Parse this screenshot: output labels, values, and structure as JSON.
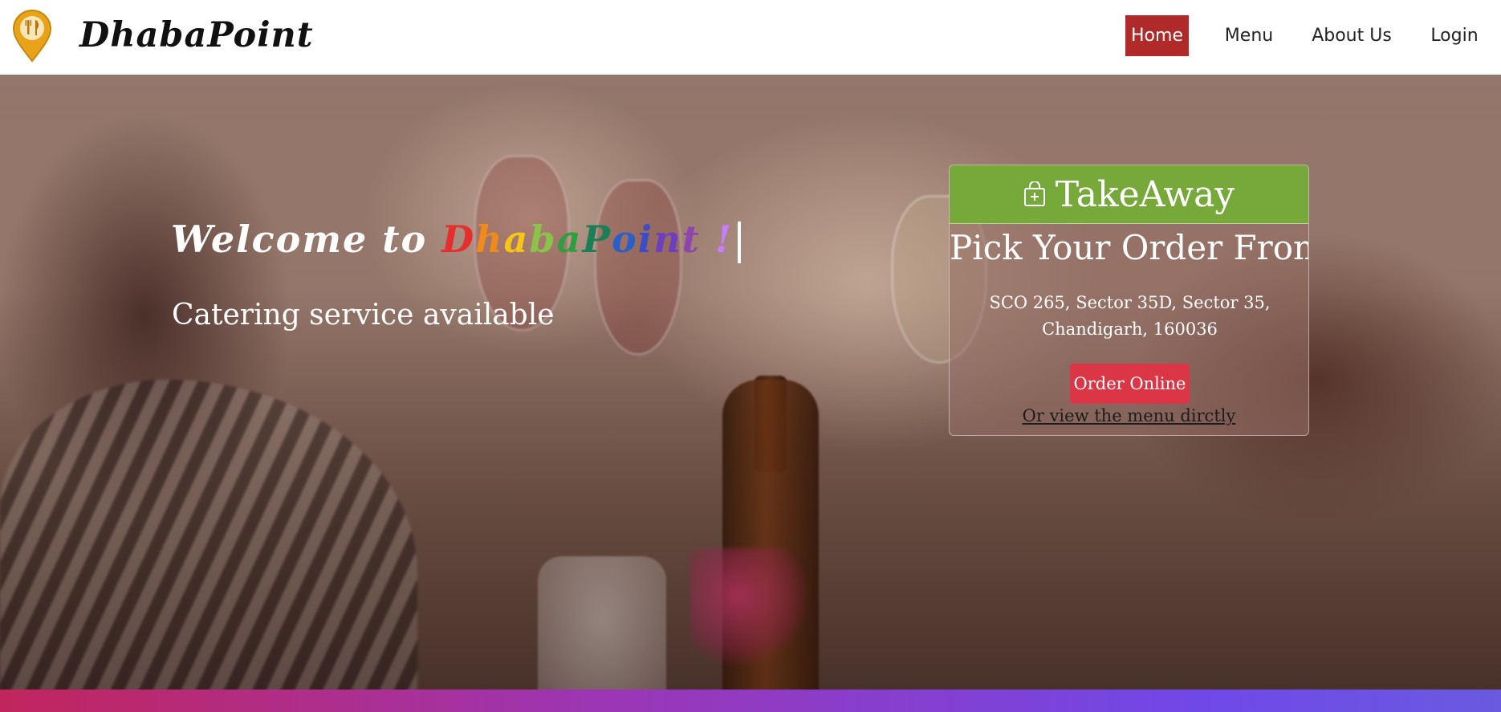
{
  "brand": {
    "name": "DhabaPoint",
    "logo_icon": "map-pin-fork-knife-icon"
  },
  "nav": {
    "items": [
      {
        "label": "Home",
        "active": true
      },
      {
        "label": "Menu",
        "active": false
      },
      {
        "label": "About Us",
        "active": false
      },
      {
        "label": "Login",
        "active": false
      }
    ]
  },
  "hero": {
    "welcome_prefix": "Welcome to",
    "welcome_brand": "DhabaPoint",
    "welcome_suffix": " !",
    "tagline": "Catering service available",
    "rainbow_colors": [
      "#e52e2e",
      "#f08a1d",
      "#f5c518",
      "#8bc34a",
      "#2e9e3f",
      "#1a7f56",
      "#2a5fc9",
      "#3d4bc4",
      "#6b3fc0",
      "#8e44ad",
      "#c77dff"
    ]
  },
  "takeaway": {
    "icon": "shopping-bag-plus-icon",
    "title": "TakeAway",
    "subtitle": "Pick Your Order From",
    "address_line1": "SCO 265, Sector 35D, Sector 35,",
    "address_line2": "Chandigarh, 160036",
    "order_button": "Order Online",
    "menu_link": "Or view the menu dirctly"
  },
  "colors": {
    "nav_active": "#b02a2a",
    "card_header": "#76a93a",
    "order_button": "#dc3545",
    "bottom_strip_start": "#c2255c",
    "bottom_strip_end": "#6a5ae0"
  }
}
